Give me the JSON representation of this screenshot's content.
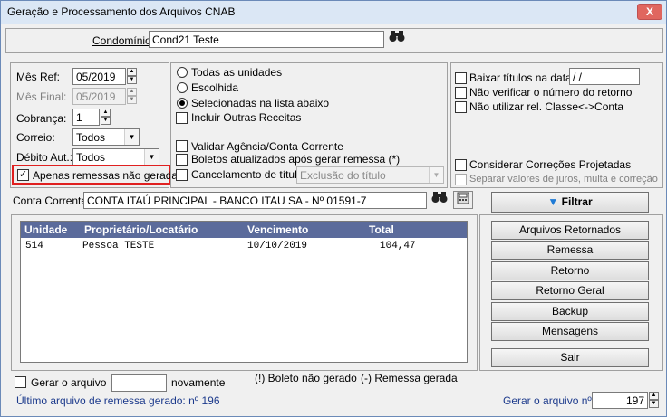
{
  "window": {
    "title": "Geração e Processamento dos Arquivos CNAB",
    "close_label": "X"
  },
  "condominio": {
    "label": "Condomínio:",
    "value": "Cond21 Teste"
  },
  "left": {
    "mes_ref_label": "Mês Ref:",
    "mes_ref_value": "05/2019",
    "mes_final_label": "Mês Final:",
    "mes_final_value": "05/2019",
    "cobranca_label": "Cobrança:",
    "cobranca_value": "1",
    "correio_label": "Correio:",
    "correio_value": "Todos",
    "debito_label": "Débito Aut.:",
    "debito_value": "Todos",
    "apenas_label": "Apenas remessas não geradas"
  },
  "middle": {
    "todas_label": "Todas as unidades",
    "escolhida_label": "Escolhida",
    "selecionadas_label": "Selecionadas na lista abaixo",
    "incluir_label": "Incluir Outras Receitas",
    "validar_label": "Validar Agência/Conta Corrente",
    "boletos_label": "Boletos atualizados após gerar remessa (*)",
    "cancelamento_label": "Cancelamento de título",
    "cancelamento_value": "Exclusão do título"
  },
  "right": {
    "baixar_label": "Baixar títulos na data:",
    "baixar_value": " / /",
    "nao_verificar_label": "Não verificar o número do retorno",
    "nao_utilizar_label": "Não utilizar rel. Classe<->Conta",
    "considerar_label": "Considerar Correções Projetadas",
    "separar_label": "Separar valores de juros, multa e correção"
  },
  "conta": {
    "label": "Conta Corrente:",
    "value": "CONTA ITAÚ PRINCIPAL - BANCO ITAU SA - Nº 01591-7"
  },
  "filtrar_label": "Filtrar",
  "grid": {
    "headers": [
      "Unidade",
      "Proprietário/Locatário",
      "Vencimento",
      "Total"
    ],
    "rows": [
      {
        "unidade": "514",
        "proprietario": "Pessoa TESTE",
        "vencimento": "10/10/2019",
        "total": "104,47"
      }
    ]
  },
  "buttons": {
    "arquivos_retornados": "Arquivos Retornados",
    "remessa": "Remessa",
    "retorno": "Retorno",
    "retorno_geral": "Retorno Geral",
    "backup": "Backup",
    "mensagens": "Mensagens",
    "sair": "Sair"
  },
  "footer": {
    "gerar_label": "Gerar o arquivo",
    "gerar_value": "",
    "novamente_label": "novamente",
    "legend_boleto": "(!) Boleto não gerado",
    "legend_remessa": "(-) Remessa gerada",
    "ultimo_label": "Último arquivo de remessa gerado: nº 196",
    "gerar_n_label": "Gerar o arquivo nº:",
    "gerar_n_value": "197"
  },
  "colors": {
    "highlight": "#e02020",
    "grid_header": "#5b6b9b",
    "accent_blue": "#1c3a8c"
  }
}
